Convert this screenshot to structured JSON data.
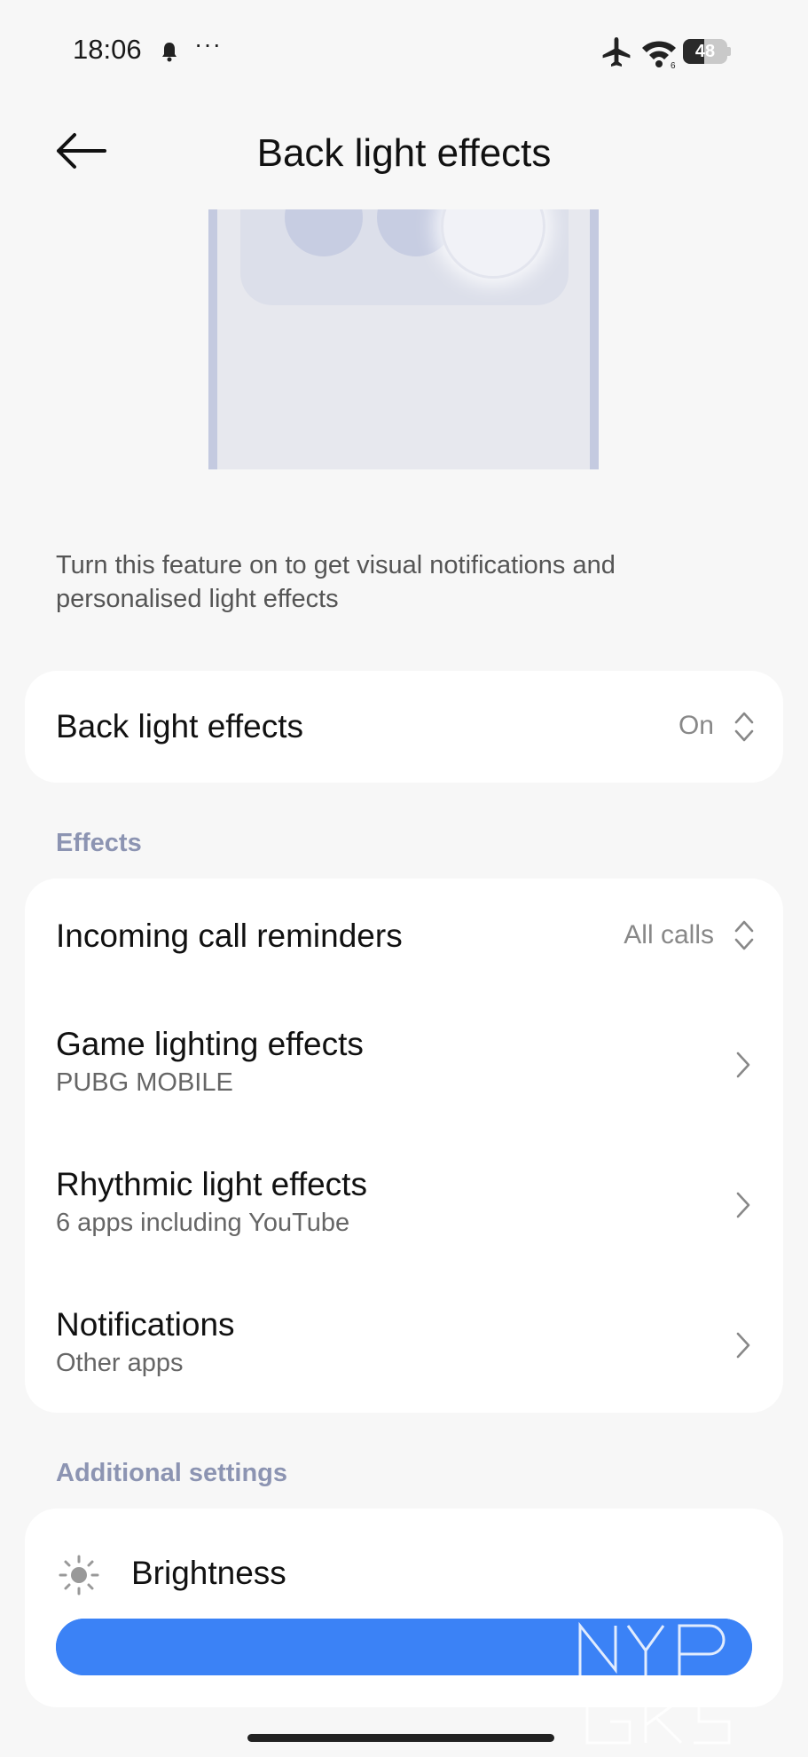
{
  "status_bar": {
    "time": "18:06",
    "more": "···",
    "battery_level": "48",
    "battery_fraction": 0.48,
    "icons": [
      "bell-icon",
      "airplane-icon",
      "wifi-icon",
      "battery-icon"
    ],
    "wifi_badge": "6"
  },
  "header": {
    "title": "Back light effects",
    "back_icon": "arrow-left-icon"
  },
  "description": "Turn this feature on to get visual notifications and personalised light effects",
  "main_toggle": {
    "label": "Back light effects",
    "value": "On"
  },
  "effects": {
    "section_title": "Effects",
    "items": [
      {
        "title": "Incoming call reminders",
        "value": "All calls"
      },
      {
        "title": "Game lighting effects",
        "subtitle": "PUBG MOBILE"
      },
      {
        "title": "Rhythmic light effects",
        "subtitle": "6 apps including YouTube"
      },
      {
        "title": "Notifications",
        "subtitle": "Other apps"
      }
    ]
  },
  "additional": {
    "section_title": "Additional settings",
    "brightness_label": "Brightness",
    "brightness_level": 1.0
  },
  "colors": {
    "accent": "#3b82f6",
    "section_header": "#8c94b2",
    "background": "#f7f7f7"
  },
  "watermark": "NYP GKS"
}
